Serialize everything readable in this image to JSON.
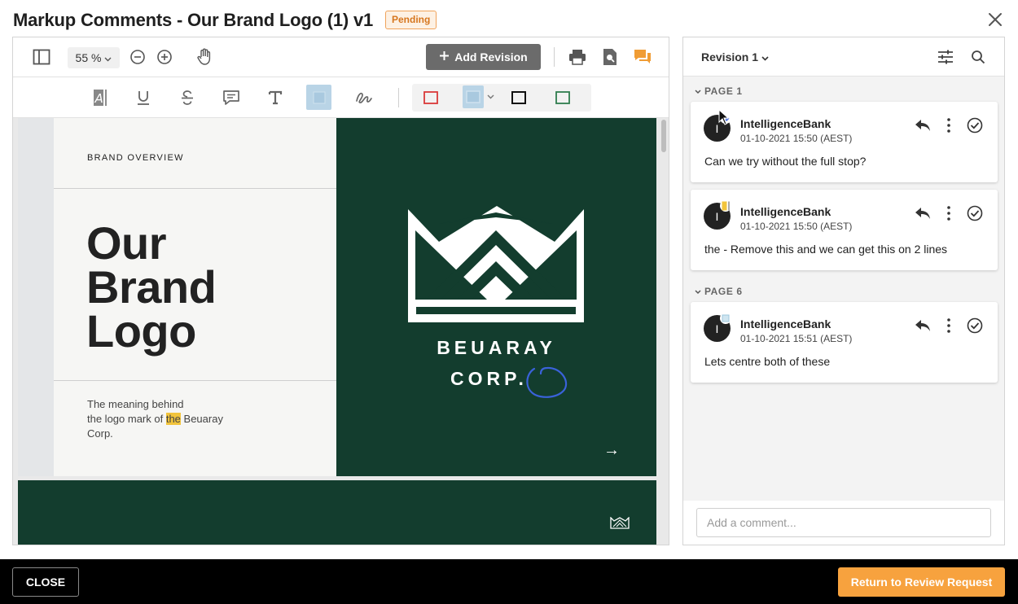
{
  "header": {
    "title": "Markup Comments - Our Brand Logo (1) v1",
    "status": "Pending"
  },
  "viewer": {
    "zoom": "55 %",
    "add_revision_label": "Add Revision"
  },
  "document": {
    "section_label": "BRAND OVERVIEW",
    "title_lines": [
      "Our",
      "Brand",
      "Logo"
    ],
    "meaning_line1": "The meaning behind",
    "meaning_line2_pre": "the logo mark of ",
    "meaning_highlight": "the",
    "meaning_line2_post": " Beuaray",
    "meaning_line3": "Corp.",
    "logo_line1": "BEUARAY",
    "logo_line2": "CORP.",
    "next_arrow": "→"
  },
  "comments_panel": {
    "revision_label": "Revision 1",
    "pages": [
      {
        "label": "PAGE 1",
        "comments": [
          {
            "avatar": "I",
            "author": "IntelligenceBank",
            "time": "01-10-2021 15:50 (AEST)",
            "text": "Can we try without the full stop?"
          },
          {
            "avatar": "I",
            "author": "IntelligenceBank",
            "time": "01-10-2021 15:50 (AEST)",
            "text": "the - Remove this and we can get this on 2 lines"
          }
        ]
      },
      {
        "label": "PAGE 6",
        "comments": [
          {
            "avatar": "I",
            "author": "IntelligenceBank",
            "time": "01-10-2021 15:51 (AEST)",
            "text": "Lets centre both of these"
          }
        ]
      }
    ],
    "comment_placeholder": "Add a comment..."
  },
  "footer": {
    "close_label": "CLOSE",
    "return_label": "Return to Review Request"
  },
  "colors": {
    "accent": "#f7a23e",
    "green": "#133d2e",
    "pending": "#d6761e",
    "markup_blue": "#3a62d9"
  }
}
